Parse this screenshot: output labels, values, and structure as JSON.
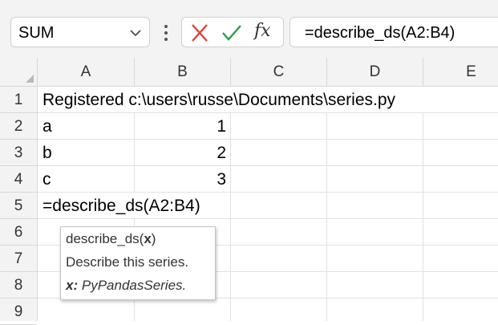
{
  "formula_bar": {
    "name_box": "SUM",
    "formula": "=describe_ds(A2:B4)",
    "icons": {
      "dropdown": "chevron-down-icon",
      "more": "vertical-ellipsis-icon",
      "cancel": "x-icon",
      "enter": "checkmark-icon",
      "function": "fx-icon"
    },
    "fx_label": "fx",
    "colors": {
      "cancel": "#e0443b",
      "enter": "#2e9e49",
      "accent": "#217346"
    }
  },
  "columns": [
    "A",
    "B",
    "C",
    "D",
    "E"
  ],
  "rows": [
    "1",
    "2",
    "3",
    "4",
    "5",
    "6",
    "7",
    "8",
    "9"
  ],
  "cells": {
    "A1": "Registered c:\\users\\russe\\Documents\\series.py",
    "A2": "a",
    "B2": "1",
    "A3": "b",
    "B3": "2",
    "A4": "c",
    "B4": "3",
    "A5": "=describe_ds(A2:B4)"
  },
  "tooltip": {
    "fn_name": "describe_ds(",
    "param": "x",
    "close": ")",
    "description": "Describe this series.",
    "param_label": "x:",
    "param_type": "PyPandasSeries."
  }
}
